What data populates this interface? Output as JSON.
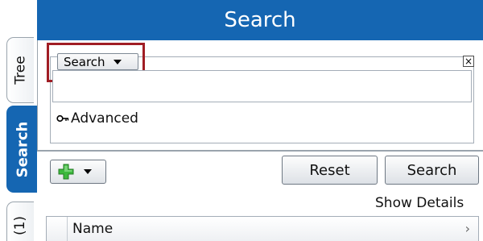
{
  "tabs": {
    "tree": "Tree",
    "search": "Search",
    "count": "(1)"
  },
  "header": {
    "title": "Search"
  },
  "criteria": {
    "field_selector": "Search",
    "close_icon": "close-icon",
    "value": "",
    "advanced_label": "Advanced"
  },
  "toolbar": {
    "add_icon": "plus-icon",
    "reset_label": "Reset",
    "search_label": "Search",
    "show_details_label": "Show Details"
  },
  "results_table": {
    "columns": [
      "Name"
    ]
  },
  "colors": {
    "header_blue": "#1566b2",
    "highlight_red": "#a01d24",
    "add_green": "#3cb93c"
  }
}
